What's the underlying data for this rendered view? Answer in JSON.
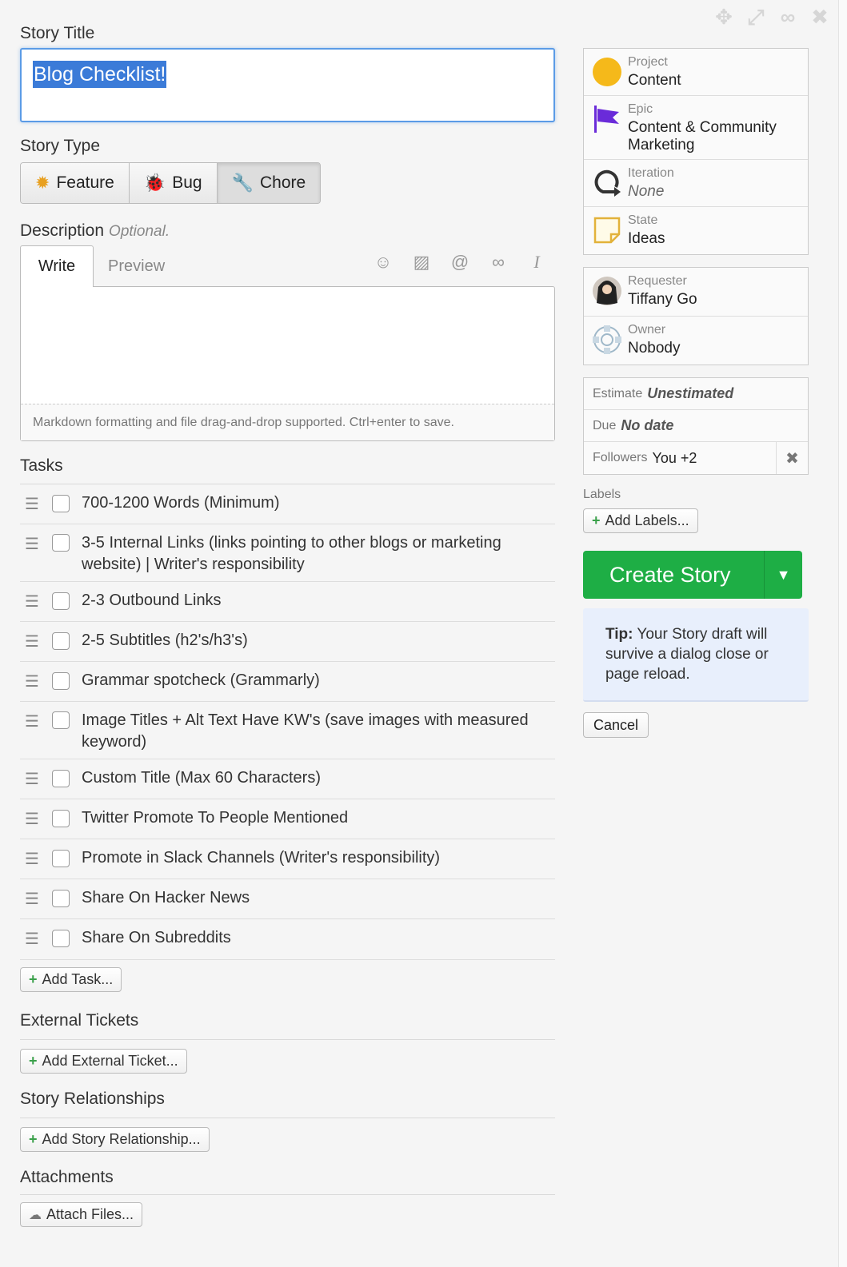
{
  "window_controls": {
    "move_icon": "move-icon",
    "expand_icon": "expand-icon",
    "link_icon": "link-icon",
    "close_icon": "close-icon"
  },
  "story_title": {
    "label": "Story Title",
    "value": "Blog Checklist!"
  },
  "story_type": {
    "label": "Story Type",
    "options": [
      {
        "label": "Feature",
        "icon": "feature-icon"
      },
      {
        "label": "Bug",
        "icon": "bug-icon"
      },
      {
        "label": "Chore",
        "icon": "wrench-icon",
        "selected": true
      }
    ]
  },
  "description": {
    "label": "Description",
    "optional": "Optional.",
    "tabs": {
      "write": "Write",
      "preview": "Preview"
    },
    "tools": [
      "emoji-icon",
      "image-icon",
      "mention-icon",
      "link-icon",
      "italic-icon"
    ],
    "footer": "Markdown formatting and file drag-and-drop supported. Ctrl+enter to save."
  },
  "tasks": {
    "label": "Tasks",
    "items": [
      "700-1200 Words (Minimum)",
      "3-5 Internal Links (links pointing to other blogs or marketing website) | Writer's responsibility",
      "2-3 Outbound Links",
      "2-5 Subtitles (h2's/h3's)",
      "Grammar spotcheck (Grammarly)",
      "Image Titles + Alt Text Have KW's (save images with measured keyword)",
      "Custom Title (Max 60 Characters)",
      "Twitter Promote To People Mentioned",
      "Promote in Slack Channels (Writer's responsibility)",
      "Share On Hacker News",
      "Share On Subreddits"
    ],
    "add_label": "Add Task..."
  },
  "external_tickets": {
    "label": "External Tickets",
    "add_label": "Add External Ticket..."
  },
  "story_relationships": {
    "label": "Story Relationships",
    "add_label": "Add Story Relationship..."
  },
  "attachments": {
    "label": "Attachments",
    "add_label": "Attach Files..."
  },
  "sidebar": {
    "project": {
      "label": "Project",
      "value": "Content",
      "color": "#f5b91a"
    },
    "epic": {
      "label": "Epic",
      "value": "Content & Community Marketing",
      "color": "#6a2bd9"
    },
    "iteration": {
      "label": "Iteration",
      "value": "None"
    },
    "state": {
      "label": "State",
      "value": "Ideas",
      "color": "#e2b23a"
    },
    "requester": {
      "label": "Requester",
      "value": "Tiffany Go"
    },
    "owner": {
      "label": "Owner",
      "value": "Nobody"
    },
    "estimate": {
      "label": "Estimate",
      "value": "Unestimated"
    },
    "due": {
      "label": "Due",
      "value": "No date"
    },
    "followers": {
      "label": "Followers",
      "value": "You +2"
    },
    "labels": {
      "label": "Labels",
      "add_label": "Add Labels..."
    },
    "create_button": "Create Story",
    "tip": {
      "bold": "Tip:",
      "text": " Your Story draft will survive a dialog close or page reload."
    },
    "cancel_button": "Cancel"
  },
  "colors": {
    "accent_green": "#1eae45",
    "focus_blue": "#5b9be6",
    "tip_bg": "#e8effc"
  }
}
